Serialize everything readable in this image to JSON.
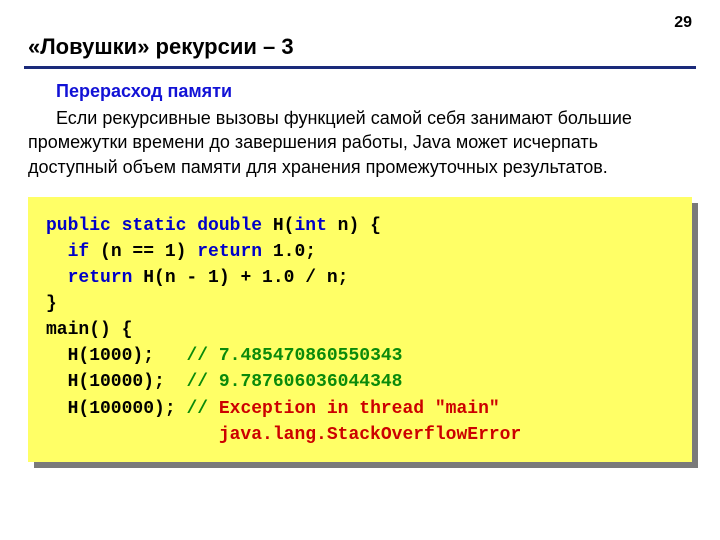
{
  "page_number": "29",
  "title": "«Ловушки» рекурсии – 3",
  "subheading": "Перерасход памяти",
  "body_text": "Если рекурсивные вызовы функцией самой себя занимают большие промежутки времени до завершения работы, Java может исчерпать доступный объем памяти для хранения промежуточных результатов.",
  "code": {
    "kw_public": "public",
    "kw_static": "static",
    "kw_double": "double",
    "fn_name": " H(",
    "kw_int": "int",
    "param_rest": " n) {",
    "l2a": "  ",
    "kw_if": "if",
    "l2b": " (n == 1) ",
    "kw_return1": "return",
    "l2c": " 1.0;",
    "l3a": "  ",
    "kw_return2": "return",
    "l3b": " H(n - 1) + 1.0 / n;",
    "l4": "}",
    "l5": "main() {",
    "l6a": "  H(1000);   ",
    "c6": "// 7.485470860550343",
    "l7a": "  H(10000);  ",
    "c7": "// 9.787606036044348",
    "l8a": "  H(100000); ",
    "c8a": "// ",
    "e8": "Exception in thread \"main\"",
    "l9pad": "                ",
    "e9": "java.lang.StackOverflowError"
  }
}
